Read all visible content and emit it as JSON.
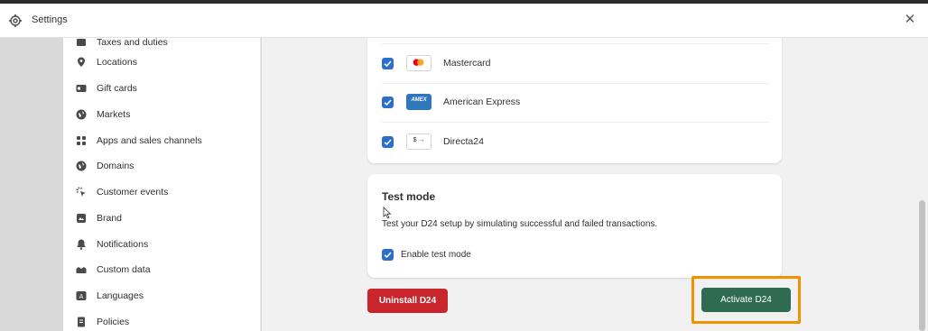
{
  "window": {
    "title": "Settings"
  },
  "sidebar": {
    "items": [
      {
        "label": "Taxes and duties",
        "icon": "taxes-icon"
      },
      {
        "label": "Locations",
        "icon": "location-pin-icon"
      },
      {
        "label": "Gift cards",
        "icon": "gift-card-icon"
      },
      {
        "label": "Markets",
        "icon": "globe-icon"
      },
      {
        "label": "Apps and sales channels",
        "icon": "apps-icon"
      },
      {
        "label": "Domains",
        "icon": "globe-icon"
      },
      {
        "label": "Customer events",
        "icon": "cursor-click-icon"
      },
      {
        "label": "Brand",
        "icon": "brand-icon"
      },
      {
        "label": "Notifications",
        "icon": "bell-icon"
      },
      {
        "label": "Custom data",
        "icon": "database-icon"
      },
      {
        "label": "Languages",
        "icon": "language-icon"
      },
      {
        "label": "Policies",
        "icon": "document-icon"
      }
    ]
  },
  "payment_methods": [
    {
      "label": "Mastercard",
      "checked": true,
      "logo": "mastercard-logo"
    },
    {
      "label": "American Express",
      "checked": true,
      "logo": "amex-logo",
      "logo_text": "AMEX"
    },
    {
      "label": "Directa24",
      "checked": true,
      "logo": "directa24-logo",
      "logo_text": "$ →"
    }
  ],
  "test_mode": {
    "title": "Test mode",
    "description": "Test your D24 setup by simulating successful and failed transactions.",
    "checkbox_label": "Enable test mode",
    "checked": true
  },
  "actions": {
    "uninstall_label": "Uninstall D24",
    "activate_label": "Activate D24"
  },
  "colors": {
    "checkbox": "#2c6ecb",
    "uninstall": "#c9252c",
    "activate": "#2f6b51",
    "highlight": "#f39200"
  }
}
